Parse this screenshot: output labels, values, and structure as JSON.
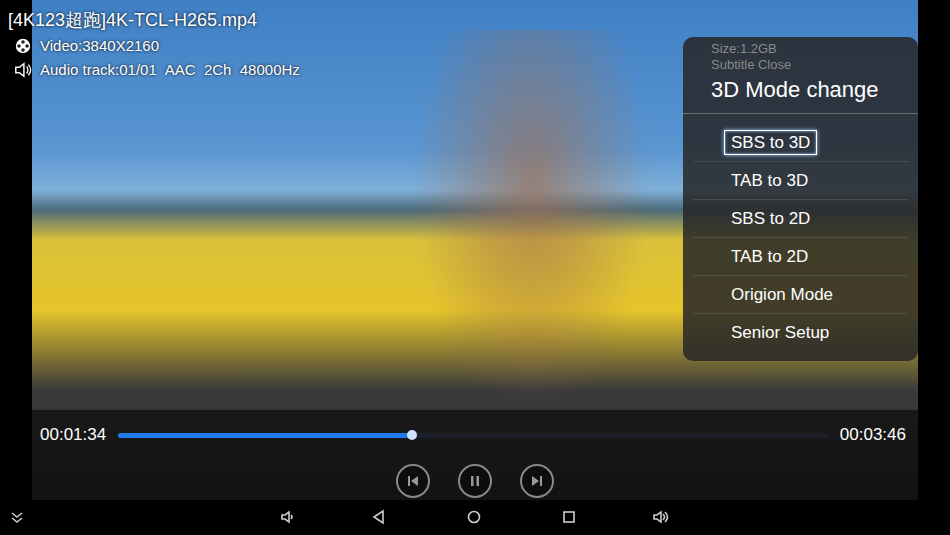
{
  "file": {
    "title": "[4K123超跑]4K-TCL-H265.mp4",
    "video": "Video:3840X2160",
    "audio": "Audio track:01/01",
    "audio_format": "AAC  2Ch  48000Hz"
  },
  "menu": {
    "info": [
      "Size:1.2GB",
      "Subtitle Close"
    ],
    "title": "3D Mode change",
    "items": [
      {
        "label": "SBS to 3D",
        "selected": true
      },
      {
        "label": "TAB to 3D",
        "selected": false
      },
      {
        "label": "SBS to 2D",
        "selected": false
      },
      {
        "label": "TAB to 2D",
        "selected": false
      },
      {
        "label": "Origion Mode",
        "selected": false
      },
      {
        "label": "Senior Setup",
        "selected": false
      }
    ]
  },
  "playback": {
    "elapsed": "00:01:34",
    "duration": "00:03:46",
    "level": 0.414,
    "playing": true
  }
}
